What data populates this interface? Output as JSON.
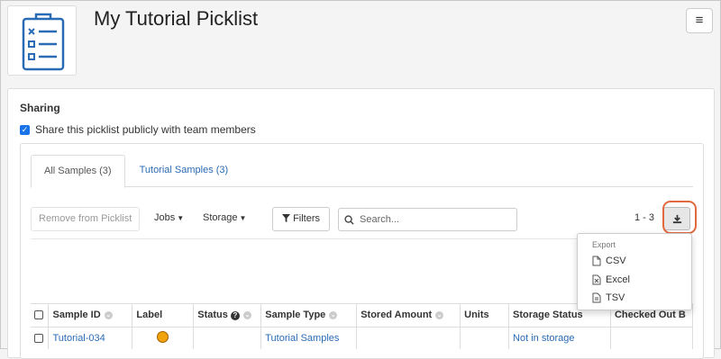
{
  "header": {
    "title": "My Tutorial Picklist",
    "app_icon": "clipboard-list-icon",
    "menu_icon": "hamburger-icon"
  },
  "sharing": {
    "title": "Sharing",
    "checkbox_label": "Share this picklist publicly with team members",
    "checked": true
  },
  "tabs": [
    {
      "label": "All Samples (3)",
      "active": true
    },
    {
      "label": "Tutorial Samples (3)",
      "active": false
    }
  ],
  "toolbar": {
    "remove_label": "Remove from Picklist",
    "jobs_label": "Jobs",
    "storage_label": "Storage",
    "filters_label": "Filters",
    "search_placeholder": "Search...",
    "paging": "1 - 3"
  },
  "export_menu": {
    "header": "Export",
    "items": [
      {
        "label": "CSV",
        "icon": "file-icon"
      },
      {
        "label": "Excel",
        "icon": "excel-file-icon"
      },
      {
        "label": "TSV",
        "icon": "text-file-icon"
      }
    ]
  },
  "table": {
    "columns": [
      "Sample ID",
      "Label",
      "Status",
      "Sample Type",
      "Stored Amount",
      "Units",
      "Storage Status",
      "Checked Out B"
    ],
    "rows": [
      {
        "sample_id": "Tutorial-034",
        "label_color": "#f0a30a",
        "status": "",
        "sample_type": "Tutorial Samples",
        "stored_amount": "",
        "units": "",
        "storage_status": "Not in storage",
        "checked_out_by": ""
      }
    ]
  },
  "colors": {
    "accent": "#2a6bb5",
    "highlight": "#e0693e"
  }
}
